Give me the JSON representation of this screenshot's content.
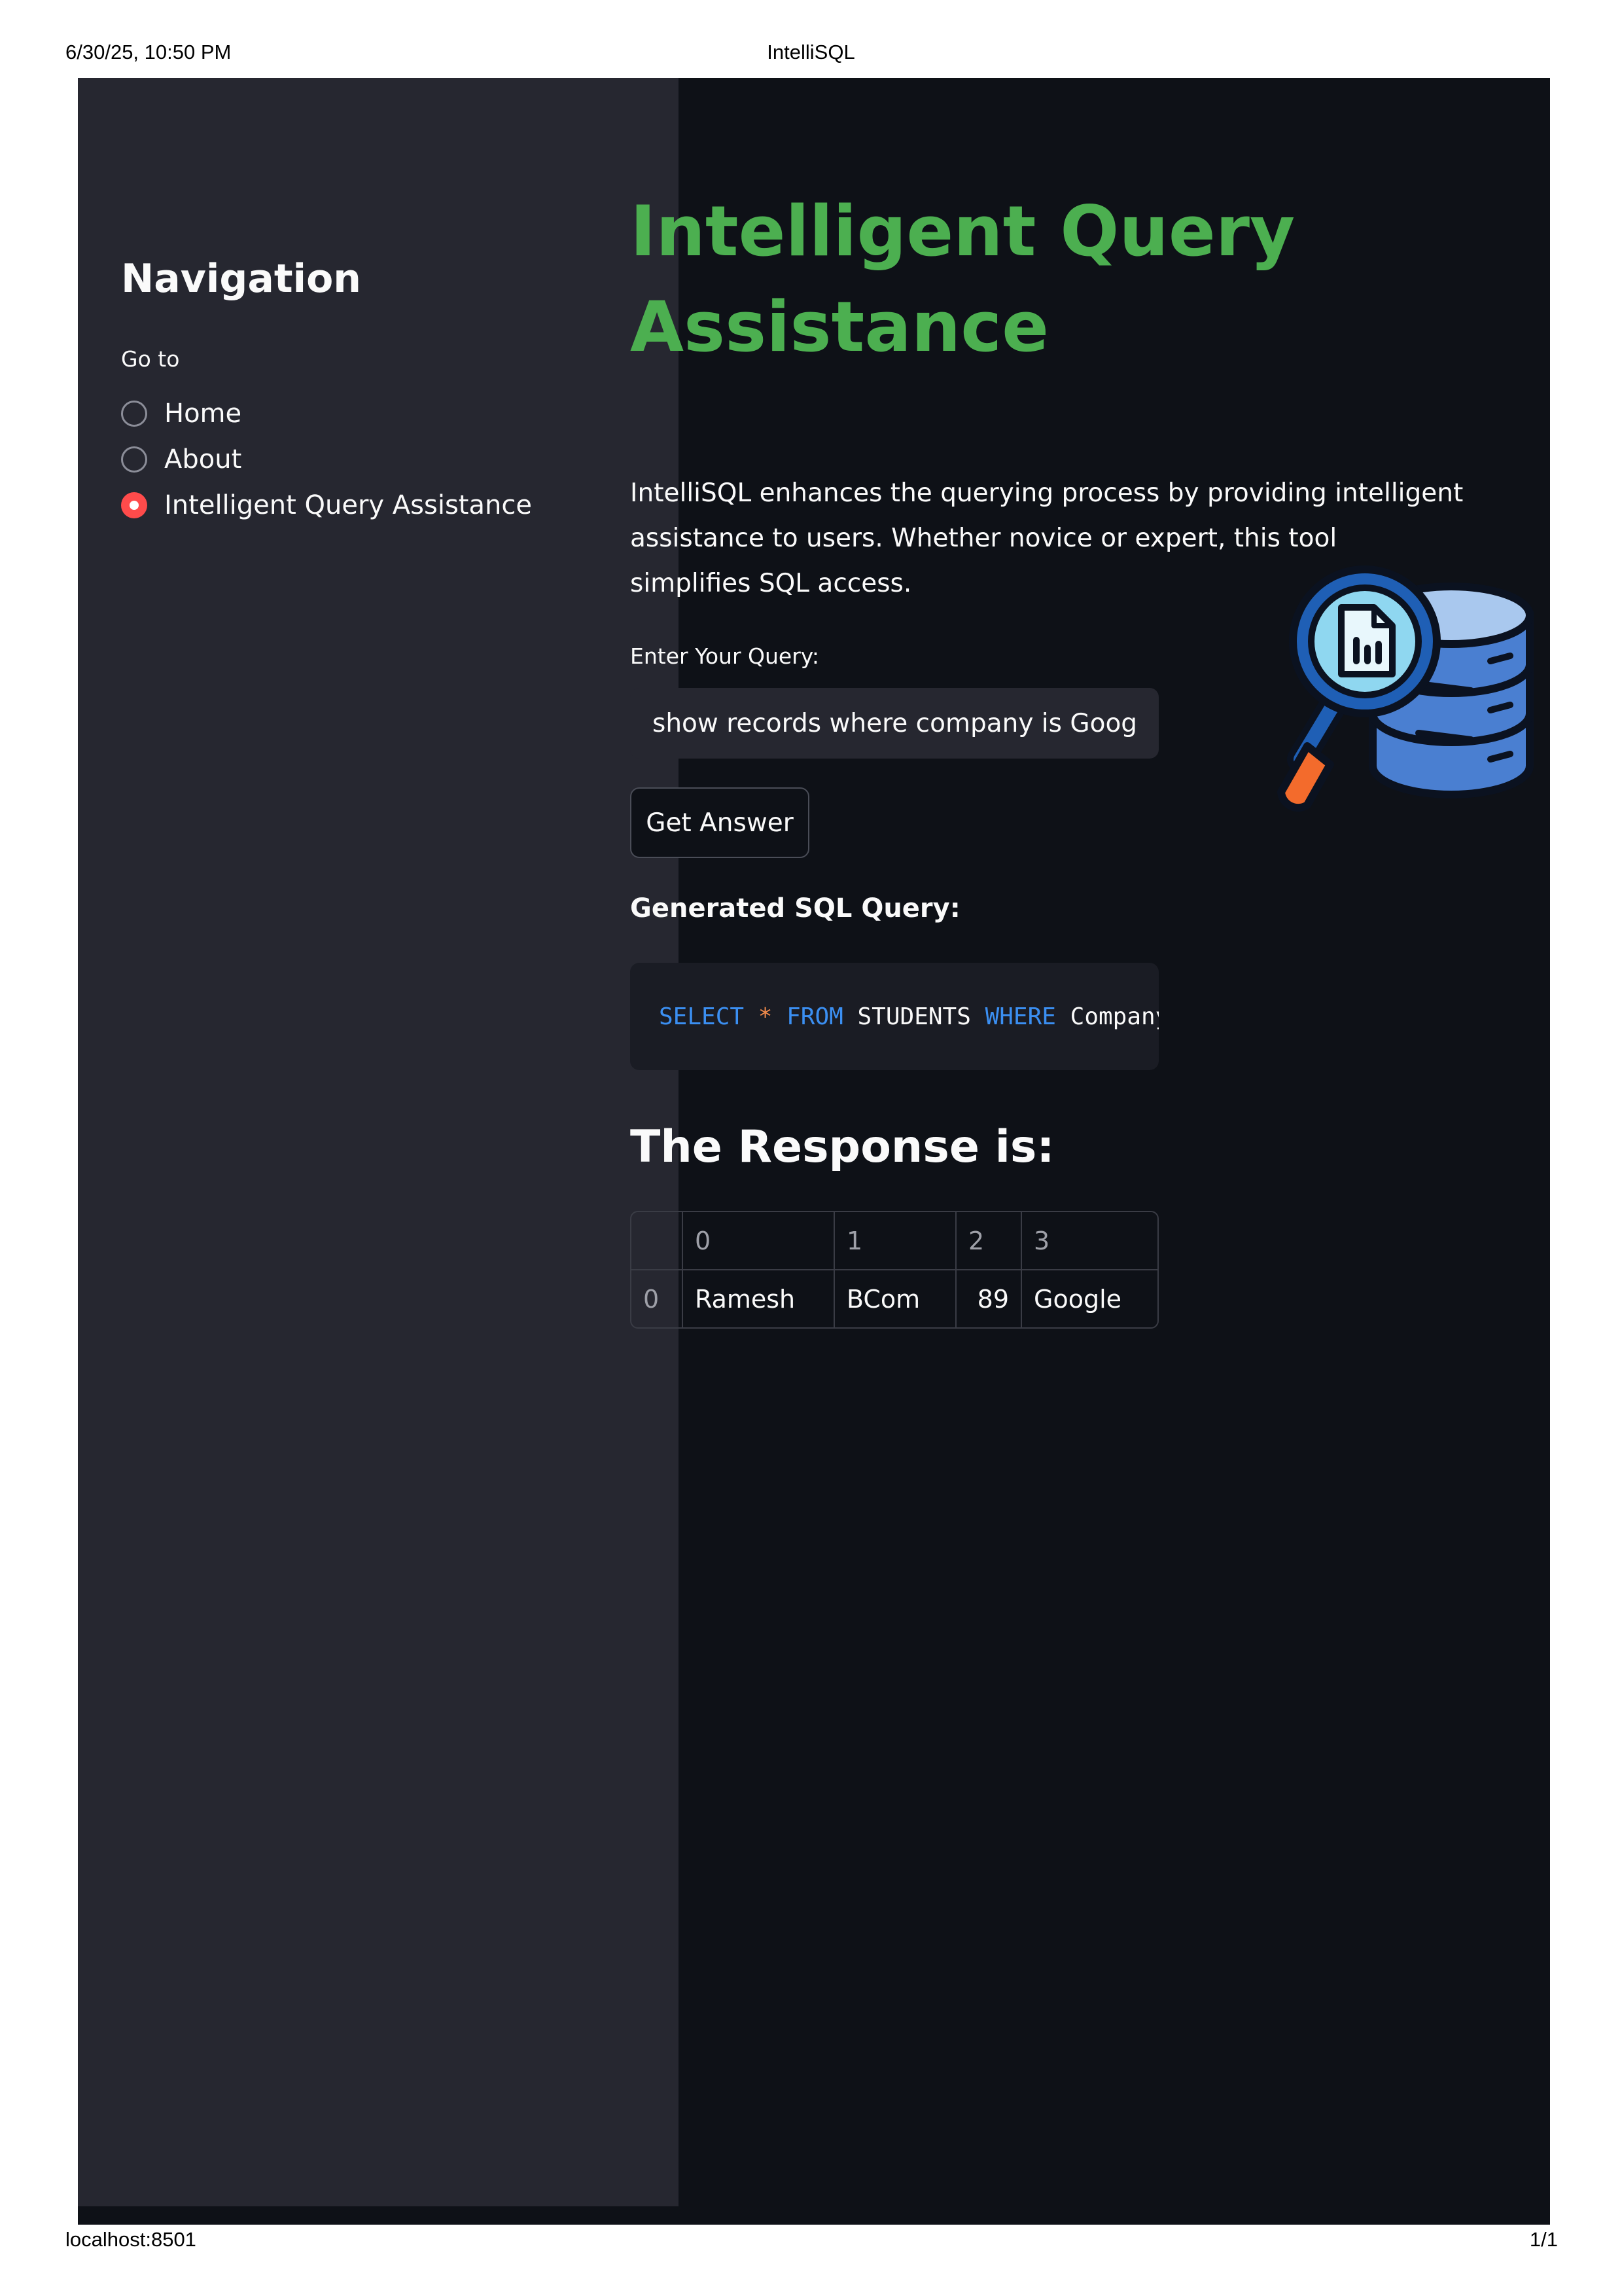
{
  "print_header": {
    "datetime": "6/30/25, 10:50 PM",
    "title": "IntelliSQL"
  },
  "print_footer": {
    "url": "localhost:8501",
    "page": "1/1"
  },
  "sidebar": {
    "title": "Navigation",
    "radio_label": "Go to",
    "options": [
      {
        "label": "Home",
        "selected": false
      },
      {
        "label": "About",
        "selected": false
      },
      {
        "label": "Intelligent Query Assistance",
        "selected": true
      }
    ]
  },
  "main": {
    "title": "Intelligent Query Assistance",
    "intro": "IntelliSQL enhances the querying process by providing intelligent assistance to users. Whether novice or expert, this tool simplifies SQL access.",
    "query_label": "Enter Your Query:",
    "query_value": "show records where company is Google",
    "button_label": "Get Answer",
    "sql_heading": "Generated SQL Query:",
    "sql_tokens": {
      "select": "SELECT",
      "star": "*",
      "from": "FROM",
      "table": "STUDENTS",
      "where": "WHERE",
      "rest": "Company='Google';"
    },
    "response_heading": "The Response is:",
    "table": {
      "columns": [
        "",
        "0",
        "1",
        "2",
        "3"
      ],
      "rows": [
        [
          "0",
          "Ramesh",
          "BCom",
          "89",
          "Google"
        ]
      ]
    },
    "icon": "database-search-icon"
  },
  "colors": {
    "accent_green": "#4caf50",
    "radio_selected": "#ff4b4b",
    "sql_keyword": "#3b8ff2",
    "sql_operator": "#f08a4b",
    "sidebar_bg": "#262730",
    "main_bg": "#0e1117"
  }
}
